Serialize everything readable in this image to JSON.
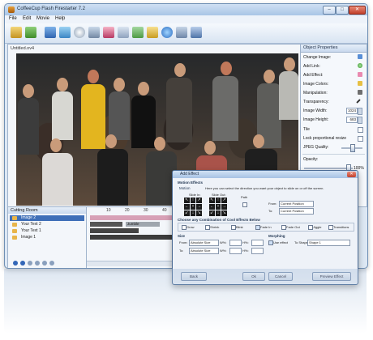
{
  "window": {
    "title": "CoffeeCup Flash Firestarter 7.2",
    "min": "–",
    "max": "□",
    "close": "✕"
  },
  "menu": [
    "File",
    "Edit",
    "Movie",
    "Help"
  ],
  "toolbar": {
    "icons": [
      "open-icon",
      "save-icon",
      "text-icon",
      "image-icon",
      "shape-icon",
      "sound-icon",
      "effect-icon",
      "export-icon",
      "preview-icon",
      "publish-icon",
      "settings-icon",
      "web-icon",
      "upload-icon"
    ]
  },
  "canvas": {
    "file_tab": "Untitled.ov4"
  },
  "properties": {
    "title": "Object Properties",
    "rows": [
      {
        "label": "Change Image:",
        "icon": "image-icon"
      },
      {
        "label": "Add Link:",
        "icon": "globe-icon"
      },
      {
        "label": "Add Effect:",
        "icon": "effect-icon"
      },
      {
        "label": "Image Colors:",
        "icon": "palette-icon"
      },
      {
        "label": "Manipulation:",
        "icon": "crop-icon"
      },
      {
        "label": "Transparency:",
        "icon": "pen-icon"
      }
    ],
    "image_width_label": "Image Width:",
    "image_width": "1024",
    "image_height_label": "Image Height:",
    "image_height": "683",
    "tile_label": "Tile",
    "lock_label": "Lock proportional resize",
    "jpeg_label": "JPEG Quality:",
    "opacity_label": "Opacity:",
    "opacity_value": "100%"
  },
  "cutting_room": {
    "title": "Cutting Room",
    "layers": [
      {
        "name": "Image 2"
      },
      {
        "name": "Your Text 2"
      },
      {
        "name": "Your Text 1"
      },
      {
        "name": "Image 1"
      }
    ]
  },
  "timeline": {
    "ticks": [
      "10",
      "20",
      "30",
      "40"
    ],
    "clip_label": "Jumble"
  },
  "dialog": {
    "title": "Add Effect",
    "close": "✕",
    "motion_effects": "Motion Effects",
    "motion": "Motion",
    "motion_desc": "Here you can select the direction you want your object to slide on or off the screen.",
    "slide_in": "Slide In:",
    "slide_out": "Slide Out:",
    "path": "Path",
    "from": "From:",
    "to": "To:",
    "current_position": "Current Position",
    "choose_combo": "Choose any Combination of Cool Effects Below",
    "effects": [
      "Grow",
      "Shrink",
      "Blink",
      "Fade In",
      "Fade Out",
      "Jiggle",
      "Transitions"
    ],
    "size": "Size",
    "morphing": "Morphing",
    "absolute_size": "Absolute Size",
    "w_pct": "W%:",
    "h_pct": "H%:",
    "use_effect": "Use effect",
    "to_shape": "To Shape:",
    "shape_value": "Shape 1",
    "back": "Back",
    "ok": "Ok",
    "cancel": "Cancel",
    "preview": "Preview Effect"
  }
}
